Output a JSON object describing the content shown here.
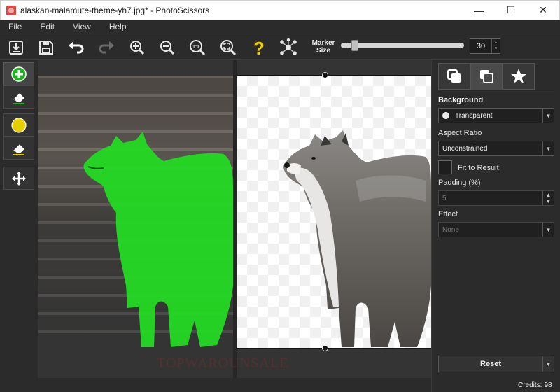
{
  "window": {
    "title": "alaskan-malamute-theme-yh7.jpg* - PhotoScissors",
    "minimize": "—",
    "maximize": "☐",
    "close": "✕"
  },
  "menu": [
    "File",
    "Edit",
    "View",
    "Help"
  ],
  "toolbar": {
    "icons": [
      "open-file-icon",
      "save-icon",
      "undo-icon",
      "redo-icon",
      "zoom-in-icon",
      "zoom-out-icon",
      "actual-size-icon",
      "fit-to-window-icon",
      "help-icon",
      "marker-network-icon"
    ],
    "marker_label_line1": "Marker",
    "marker_label_line2": "Size",
    "marker_size_value": "30",
    "marker_size_fraction": 0.1
  },
  "tools": [
    "foreground-marker-icon",
    "foreground-eraser-icon",
    "background-marker-icon",
    "background-eraser-icon",
    "move-icon"
  ],
  "colors": {
    "foreground_marker": "#1db41d",
    "background_marker": "#e8d000",
    "help": "#f1d000"
  },
  "panel": {
    "tabs": [
      "background-tab",
      "foreground-tab",
      "effects-tab"
    ],
    "background_title": "Background",
    "background_value": "Transparent",
    "aspect_label": "Aspect Ratio",
    "aspect_value": "Unconstrained",
    "fit_label": "Fit to Result",
    "padding_label": "Padding (%)",
    "padding_value": "5",
    "effect_label": "Effect",
    "effect_value": "None",
    "reset_label": "Reset",
    "credits_label": "Credits:",
    "credits_value": "98"
  },
  "canvas": {
    "watermark": "TOPWAROUNSALE"
  }
}
